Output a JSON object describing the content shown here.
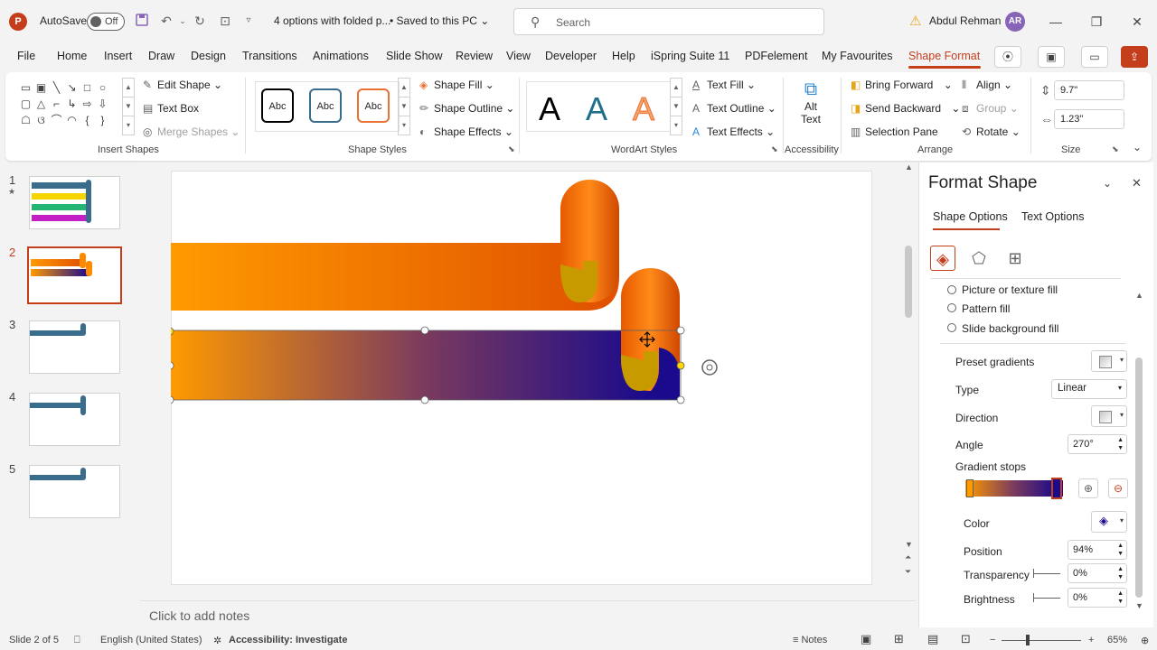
{
  "titlebar": {
    "app_logo": "P",
    "autosave_label": "AutoSave",
    "autosave_state": "Off",
    "doc_title": "4 options with folded p...",
    "save_status": "Saved to this PC",
    "search_placeholder": "Search",
    "user_name": "Abdul Rehman",
    "user_initials": "AR"
  },
  "menu": {
    "tabs": [
      "File",
      "Home",
      "Insert",
      "Draw",
      "Design",
      "Transitions",
      "Animations",
      "Slide Show",
      "Review",
      "View",
      "Developer",
      "Help",
      "iSpring Suite 11",
      "PDFelement",
      "My Favourites",
      "Shape Format"
    ],
    "active_tab": "Shape Format"
  },
  "ribbon": {
    "insert_shapes": {
      "label": "Insert Shapes",
      "edit_shape": "Edit Shape",
      "text_box": "Text Box",
      "merge_shapes": "Merge Shapes"
    },
    "shape_styles": {
      "label": "Shape Styles",
      "abc": "Abc",
      "fill": "Shape Fill",
      "outline": "Shape Outline",
      "effects": "Shape Effects"
    },
    "wordart": {
      "label": "WordArt Styles",
      "letter": "A",
      "text_fill": "Text Fill",
      "text_outline": "Text Outline",
      "text_effects": "Text Effects"
    },
    "accessibility": {
      "label": "Accessibility",
      "alt_text_1": "Alt",
      "alt_text_2": "Text"
    },
    "arrange": {
      "label": "Arrange",
      "bring_forward": "Bring Forward",
      "send_backward": "Send Backward",
      "selection_pane": "Selection Pane",
      "align": "Align",
      "group": "Group",
      "rotate": "Rotate"
    },
    "size": {
      "label": "Size",
      "height": "9.7\"",
      "width": "1.23\""
    }
  },
  "slides": {
    "numbers": [
      "1",
      "2",
      "3",
      "4",
      "5"
    ],
    "star": "★",
    "selected": 2
  },
  "notes_placeholder": "Click to add notes",
  "format_pane": {
    "title": "Format Shape",
    "tab_shape": "Shape Options",
    "tab_text": "Text Options",
    "fill_options": [
      "Picture or texture fill",
      "Pattern fill",
      "Slide background fill"
    ],
    "preset_gradients": "Preset gradients",
    "type_label": "Type",
    "type_value": "Linear",
    "direction_label": "Direction",
    "angle_label": "Angle",
    "angle_value": "270°",
    "gradient_stops": "Gradient stops",
    "color_label": "Color",
    "position_label": "Position",
    "position_value": "94%",
    "transparency_label": "Transparency",
    "transparency_value": "0%",
    "brightness_label": "Brightness",
    "brightness_value": "0%"
  },
  "status": {
    "slide_info": "Slide 2 of 5",
    "language": "English (United States)",
    "accessibility": "Accessibility: Investigate",
    "notes": "Notes",
    "zoom": "65%"
  },
  "colors": {
    "accent": "#c43e1c",
    "orange": "#ff9a00",
    "orange_dark": "#e05000",
    "navy": "#1a0a8c",
    "gold": "#c79a00"
  }
}
